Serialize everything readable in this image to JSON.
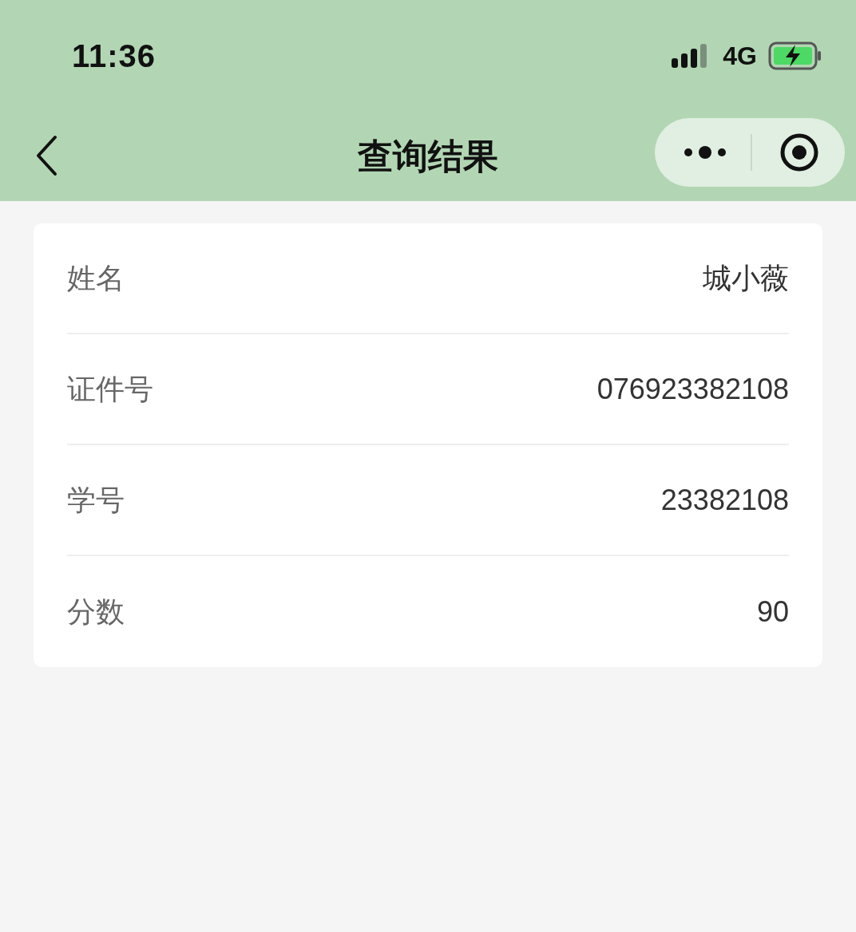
{
  "status_bar": {
    "time": "11:36",
    "network": "4G"
  },
  "nav_bar": {
    "title": "查询结果"
  },
  "rows": [
    {
      "label": "姓名",
      "value": "城小薇"
    },
    {
      "label": "证件号",
      "value": "076923382108"
    },
    {
      "label": "学号",
      "value": "23382108"
    },
    {
      "label": "分数",
      "value": "90"
    }
  ]
}
